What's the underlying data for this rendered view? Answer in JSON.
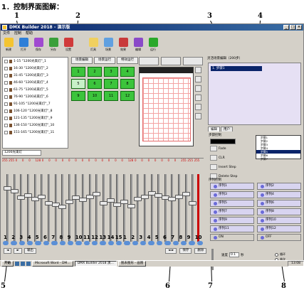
{
  "caption": "1．控制界面图解：",
  "callouts_top": [
    "1",
    "2",
    "3",
    "4"
  ],
  "callouts_bottom": [
    "5",
    "6",
    "7",
    "8"
  ],
  "window": {
    "title": "DMX Builder 2018 - 演示版",
    "menu": [
      "文件",
      "控制",
      "帮助"
    ],
    "controls": [
      "_",
      "□",
      "×"
    ]
  },
  "toolbar": {
    "tools": [
      {
        "label": "新建",
        "color": "#f4c430"
      },
      {
        "label": "打开",
        "color": "#2f7fd8"
      },
      {
        "label": "保存",
        "color": "#a04ad0"
      },
      {
        "label": "另存",
        "color": "#3a9f3a"
      },
      {
        "label": "设置",
        "color": "#d03a3a"
      },
      {
        "label": "灯具",
        "color": "#f0d060"
      },
      {
        "label": "场景",
        "color": "#60a0e0"
      },
      {
        "label": "效果",
        "color": "#c83a3a"
      },
      {
        "label": "编辑",
        "color": "#8a4ac8"
      },
      {
        "label": "运行",
        "color": "#2aa82a"
      }
    ]
  },
  "fixtures": {
    "rows": [
      "1-15  \"1200光束灯\"_1",
      "16-30  \"1200光束灯\"_2",
      "31-45  \"1200光束灯\"_3",
      "46-60  \"1200光束灯\"_4",
      "61-75  \"1200光束灯\"_5",
      "76-90  \"1200光束灯\"_6",
      "91-105  \"1200光束灯\"_7",
      "106-120  \"1200光束灯\"_8",
      "121-135  \"1200光束灯\"_9",
      "136-150  \"1200光束灯\"_10",
      "151-165  \"1200光束灯\"_11"
    ],
    "combo": "1200光束灯"
  },
  "scenes": {
    "tabs": [
      "场景编辑",
      "场景运行",
      "特效运行"
    ],
    "buttons": [
      "1",
      "2",
      "3",
      "4",
      "5",
      "6",
      "7",
      "8",
      "9",
      "10",
      "11",
      "12"
    ]
  },
  "faders": {
    "values": [
      "255",
      "255",
      "0",
      "0",
      "0",
      "128",
      "0",
      "0",
      "0",
      "0",
      "0",
      "0",
      "0",
      "0",
      "0",
      "0",
      "0",
      "0",
      "0",
      "128",
      "0",
      "0",
      "0",
      "0",
      "0",
      "0",
      "0",
      "255",
      "255",
      "255"
    ],
    "levels": [
      0.82,
      0.78,
      0.68,
      0.72,
      0.66,
      0.7,
      0.6,
      0.58,
      0.55,
      0.62,
      0.68,
      0.65,
      0.7,
      0.74,
      0.6,
      0.64,
      0.58,
      0.62,
      0.56,
      0.66,
      0.7,
      0.75,
      0.72,
      0.68,
      0.66,
      0.7,
      0.74,
      0.6
    ],
    "channel_numbers": [
      "1",
      "2",
      "3",
      "4",
      "5",
      "6",
      "7",
      "8",
      "9",
      "10",
      "11",
      "12",
      "13",
      "14",
      "15",
      "1",
      "2",
      "3",
      "4",
      "5",
      "6",
      "7",
      "8",
      "9",
      "10"
    ],
    "left_buttons": [
      "◄",
      "►",
      "输出"
    ],
    "right_buttons": [
      "◄ ►",
      "保存",
      "删除"
    ]
  },
  "right_panel": {
    "title": "灵活场景编辑（200步）",
    "list_selected": "1. 步骤1",
    "tabs": [
      "编辑",
      "用户"
    ],
    "step_title": "步骤控制",
    "step_options": [
      "Fade",
      "CLR",
      "Insert Step",
      "Delete Step"
    ],
    "step_list": [
      "步骤1",
      "步骤2",
      "步骤3",
      "步骤4",
      "步骤5",
      "步骤6",
      "步骤7"
    ],
    "seq_title": "序列控制",
    "sequences": [
      "序列1",
      "序列2",
      "序列3",
      "序列4",
      "序列5",
      "序列6",
      "序列7",
      "序列8",
      "序列9",
      "序列10",
      "序列11",
      "序列12",
      "ON",
      "OFF"
    ],
    "speed_label": "速度",
    "speed_value": "0.1",
    "speed_unit": "秒",
    "fade_label": "渐时",
    "fade_value": "0.1",
    "fade_unit": "秒",
    "modes": [
      "循环",
      "单次",
      "停止"
    ]
  },
  "taskbar": {
    "start": "开始",
    "tasks": [
      "Microsoft Word - DM…",
      "DMX Builder 2018 演…",
      "图表图形 - 画图"
    ],
    "active_task": 1,
    "clock": "13:08"
  }
}
